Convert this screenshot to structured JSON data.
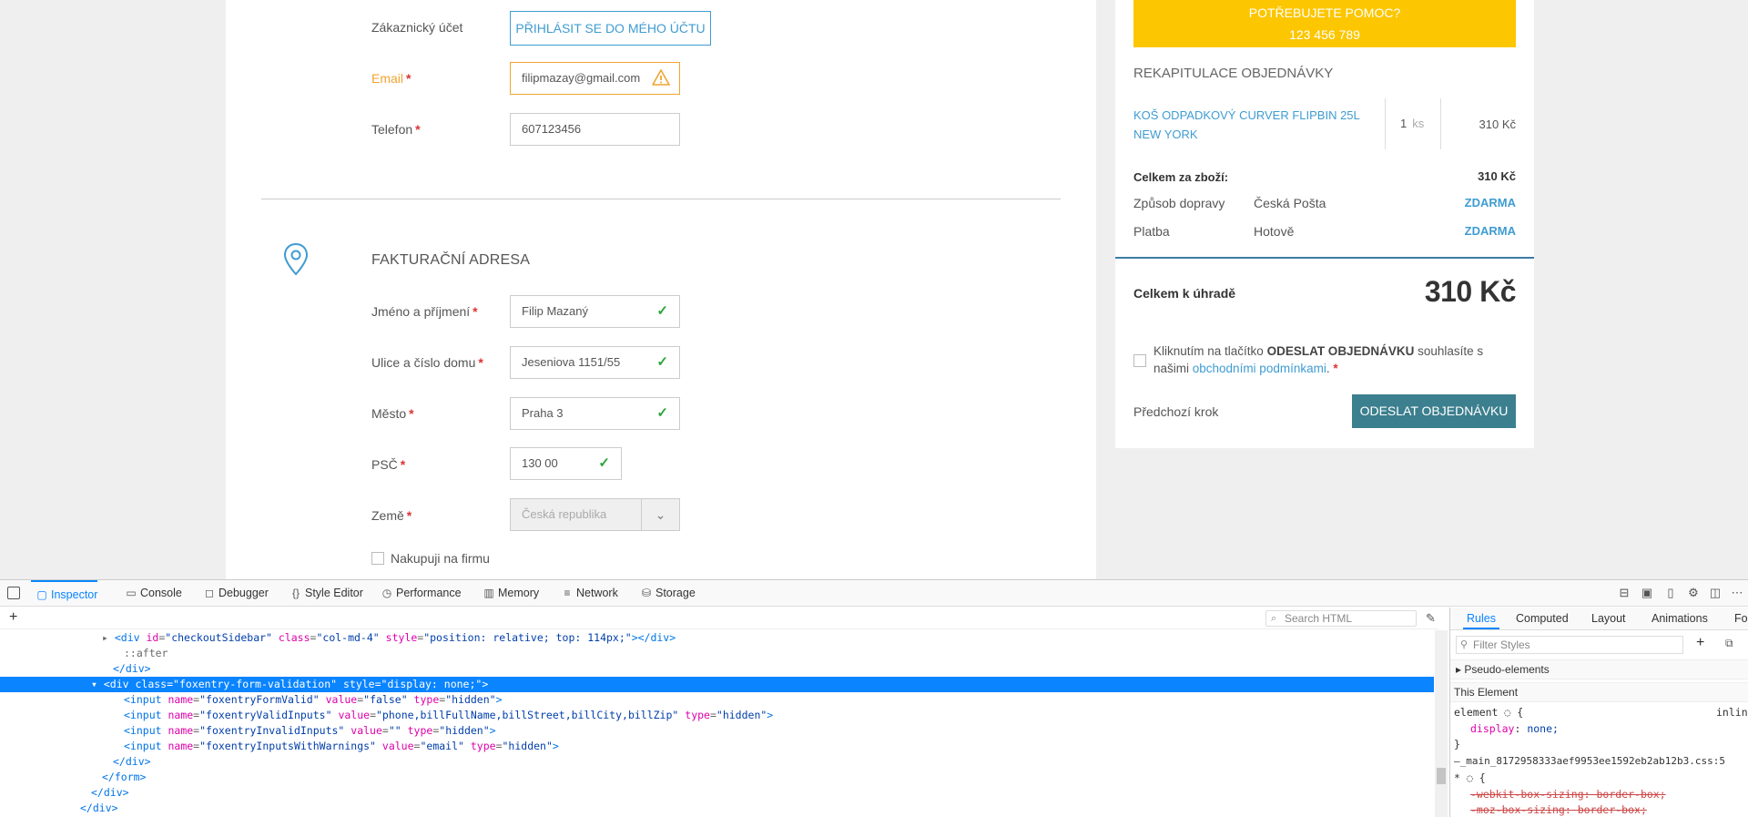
{
  "customer": {
    "account_label": "Zákaznický účet",
    "login_button": "PŘIHLÁSIT SE DO MÉHO ÚČTU",
    "email_label": "Email",
    "email_value": "filipmazay@gmail.com",
    "phone_label": "Telefon",
    "phone_value": "607123456",
    "required_mark": "*"
  },
  "billing": {
    "section_title": "FAKTURAČNÍ ADRESA",
    "name_label": "Jméno a příjmení",
    "name_value": "Filip Mazaný",
    "street_label": "Ulice a číslo domu",
    "street_value": "Jeseniova 1151/55",
    "city_label": "Město",
    "city_value": "Praha 3",
    "zip_label": "PSČ",
    "zip_value": "130 00",
    "country_label": "Země",
    "country_value": "Česká republika",
    "company_checkbox_label": "Nakupuji na firmu"
  },
  "sidebar": {
    "help_line1": "POTŘEBUJETE POMOC?",
    "help_line2": "123 456 789",
    "recap_title": "REKAPITULACE OBJEDNÁVKY",
    "product_name": "KOŠ ODPADKOVÝ CURVER FLIPBIN 25L NEW YORK",
    "product_qty": "1",
    "product_unit": "ks",
    "product_price": "310 Kč",
    "goods_total_label": "Celkem za zboží:",
    "goods_total_value": "310 Kč",
    "shipping_label": "Způsob dopravy",
    "shipping_method": "Česká Pošta",
    "shipping_price": "ZDARMA",
    "payment_label": "Platba",
    "payment_method": "Hotově",
    "payment_price": "ZDARMA",
    "total_label": "Celkem k úhradě",
    "total_value": "310 Kč",
    "terms_pre": "Kliknutím na tlačítko ",
    "terms_bold": "ODESLAT OBJEDNÁVKU",
    "terms_mid": " souhlasíte s našimi ",
    "terms_link": "obchodními podmínkami",
    "terms_post": ". ",
    "prev_step": "Předchozí krok",
    "submit_button": "ODESLAT OBJEDNÁVKU"
  },
  "devtools": {
    "tabs": [
      "Inspector",
      "Console",
      "Debugger",
      "Style Editor",
      "Performance",
      "Memory",
      "Network",
      "Storage"
    ],
    "active_tab": "Inspector",
    "search_placeholder": "Search HTML",
    "markup_lines": [
      {
        "open": "<div ",
        "attrs": [
          [
            "id",
            "checkoutSidebar"
          ],
          [
            "class",
            "col-md-4"
          ],
          [
            "style",
            "position: relative; top: 114px;"
          ]
        ],
        "close": "></div>",
        "tw": "▸"
      },
      {
        "text": "::after"
      },
      {
        "text": "</div>"
      },
      {
        "open": "<div ",
        "attrs": [
          [
            "class",
            "foxentry-form-validation"
          ],
          [
            "style",
            "display: none;"
          ]
        ],
        "close": ">",
        "tw": "▾"
      },
      {
        "open": "<input ",
        "attrs": [
          [
            "name",
            "foxentryFormValid"
          ],
          [
            "value",
            "false"
          ],
          [
            "type",
            "hidden"
          ]
        ],
        "close": ">"
      },
      {
        "open": "<input ",
        "attrs": [
          [
            "name",
            "foxentryValidInputs"
          ],
          [
            "value",
            "phone,billFullName,billStreet,billCity,billZip"
          ],
          [
            "type",
            "hidden"
          ]
        ],
        "close": ">"
      },
      {
        "open": "<input ",
        "attrs": [
          [
            "name",
            "foxentryInvalidInputs"
          ],
          [
            "value",
            ""
          ],
          [
            "type",
            "hidden"
          ]
        ],
        "close": ">"
      },
      {
        "open": "<input ",
        "attrs": [
          [
            "name",
            "foxentryInputsWithWarnings"
          ],
          [
            "value",
            "email"
          ],
          [
            "type",
            "hidden"
          ]
        ],
        "close": ">"
      },
      {
        "text": "</div>"
      },
      {
        "text": "</form>"
      },
      {
        "text": "</div>"
      },
      {
        "text": "</div>"
      }
    ],
    "rules_tabs": [
      "Rules",
      "Computed",
      "Layout",
      "Animations",
      "Fon"
    ],
    "filter_placeholder": "Filter Styles",
    "pseudo_elements": "Pseudo-elements",
    "this_element": "This Element",
    "rule_element_selector": "element",
    "rule_inline": "inlin",
    "rule_display_prop": "display",
    "rule_display_val": "none;",
    "stylesheet_ref": "_main_8172958333aef9953ee1592eb2ab12b3.css:5",
    "universal_selector": "*",
    "strike_1_prop": "-webkit-box-sizing:",
    "strike_1_val": "border-box;",
    "strike_2_prop": "-moz-box-sizing:",
    "strike_2_val": "border-box;"
  },
  "colors": {
    "accent_blue": "#3f9cd2",
    "help_yellow": "#fcc600",
    "submit_teal": "#3c7f8e",
    "devtools_select": "#0a84ff",
    "valid_green": "#2aa43a",
    "warning_orange": "#f0a431"
  }
}
